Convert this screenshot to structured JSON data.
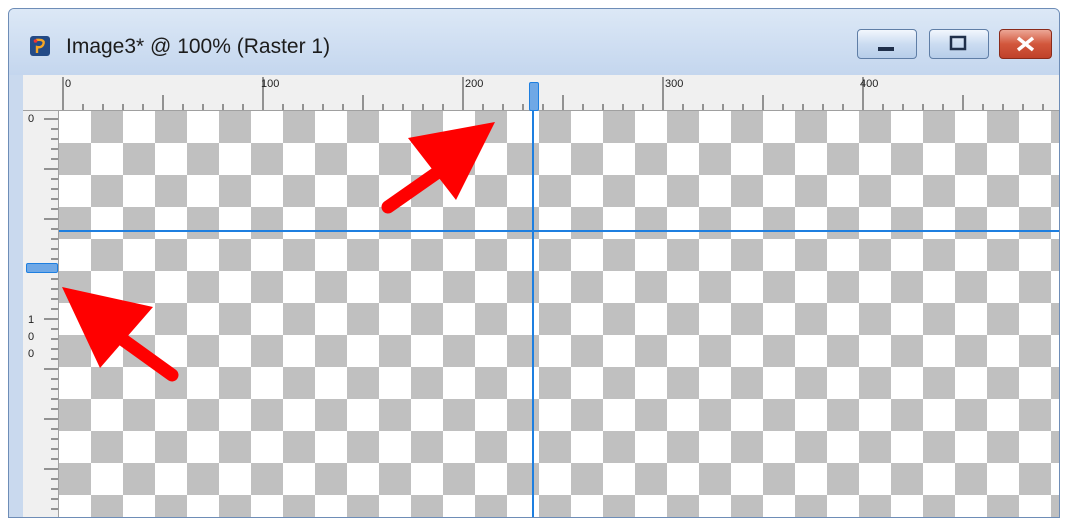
{
  "window": {
    "title": "Image3* @ 100% (Raster 1)",
    "controls": [
      "minimize",
      "maximize",
      "close"
    ]
  },
  "ruler_h": {
    "labels": [
      "0",
      "100",
      "200",
      "300",
      "400"
    ]
  },
  "ruler_v": {
    "labels": [
      "0",
      "1",
      "0",
      "0"
    ]
  },
  "colors": {
    "guide": "#1e7fe0",
    "arrow": "#ff0000",
    "checker": "#c0c0c0",
    "title_bar": "#d3e1f3"
  },
  "icons": [
    "psp-app-icon",
    "minimize-icon",
    "maximize-icon",
    "close-icon"
  ]
}
